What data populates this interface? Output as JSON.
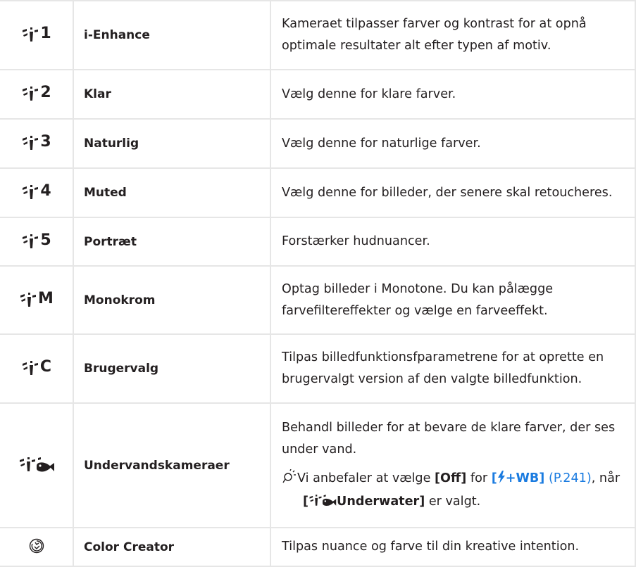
{
  "colors": {
    "text": "#231f20",
    "border": "#e6e6e6",
    "link": "#1a7be0"
  },
  "rows": [
    {
      "icon": "picture-mode-icon",
      "suffix": "1",
      "name": "i-Enhance",
      "desc": "Kameraet tilpasser farver og kontrast for at opnå optimale resultater alt efter typen af motiv."
    },
    {
      "icon": "picture-mode-icon",
      "suffix": "2",
      "name": "Klar",
      "desc": "Vælg denne for klare farver."
    },
    {
      "icon": "picture-mode-icon",
      "suffix": "3",
      "name": "Naturlig",
      "desc": "Vælg denne for naturlige farver."
    },
    {
      "icon": "picture-mode-icon",
      "suffix": "4",
      "name": "Muted",
      "desc": "Vælg denne for billeder, der senere skal retoucheres."
    },
    {
      "icon": "picture-mode-icon",
      "suffix": "5",
      "name": "Portræt",
      "desc": "Forstærker hudnuancer."
    },
    {
      "icon": "picture-mode-icon",
      "suffix": "M",
      "name": "Monokrom",
      "desc": "Optag billeder i Monotone. Du kan pålægge farvefiltereffekter og vælge en farveeffekt."
    },
    {
      "icon": "picture-mode-icon",
      "suffix": "C",
      "name": "Brugervalg",
      "desc": "Tilpas billedfunktionsfparametrene for at oprette en brugervalgt version af den valgte billedfunktion."
    },
    {
      "icon": "underwater-mode-icon",
      "suffix": "",
      "name": "Undervandskameraer",
      "desc": "Behandl billeder for at bevare de klare farver, der ses under vand.",
      "note": {
        "lead": "Vi anbefaler at vælge ",
        "off": "[Off]",
        "for": " for ",
        "flash_open": "[",
        "flash_rest": "+WB]",
        "page_ref": "(P.241)",
        "after": ", når",
        "mode_open": "[",
        "mode_label": "Underwater]",
        "tail": " er valgt."
      }
    },
    {
      "icon": "color-creator-icon",
      "suffix": "",
      "name": "Color Creator",
      "desc": "Tilpas nuance og farve til din kreative intention."
    }
  ]
}
